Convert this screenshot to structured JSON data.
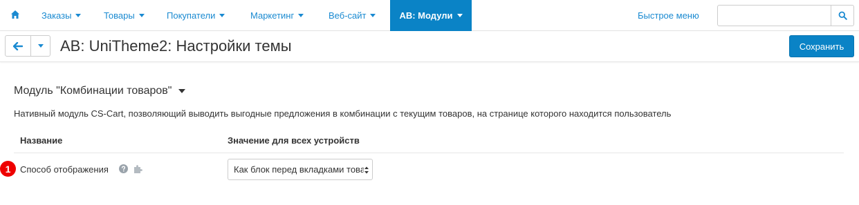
{
  "nav": {
    "items": [
      {
        "label": "Заказы"
      },
      {
        "label": "Товары"
      },
      {
        "label": "Покупатели"
      },
      {
        "label": "Маркетинг"
      },
      {
        "label": "Веб-сайт"
      },
      {
        "label": "AB: Модули"
      }
    ],
    "quick_menu": "Быстрое меню",
    "search_value": "",
    "accent_color": "#0a83c6",
    "link_color": "#1a8ad1"
  },
  "titlebar": {
    "title": "AB: UniTheme2: Настройки темы",
    "save_label": "Сохранить"
  },
  "section": {
    "title": "Модуль \"Комбинации товаров\"",
    "description": "Нативный модуль CS-Cart, позволяющий выводить выгодные предложения в комбинации с текущим товаров, на странице которого находится пользователь"
  },
  "table": {
    "headers": [
      "Название",
      "Значение для всех устройств"
    ],
    "rows": [
      {
        "badge": "1",
        "label": "Способ отображения",
        "value": "Как блок перед вкладками товара"
      }
    ]
  },
  "icons": {
    "home": "home-icon",
    "search": "search-icon",
    "back": "arrow-left-icon",
    "help": "question-circle-icon",
    "puzzle": "puzzle-icon"
  }
}
